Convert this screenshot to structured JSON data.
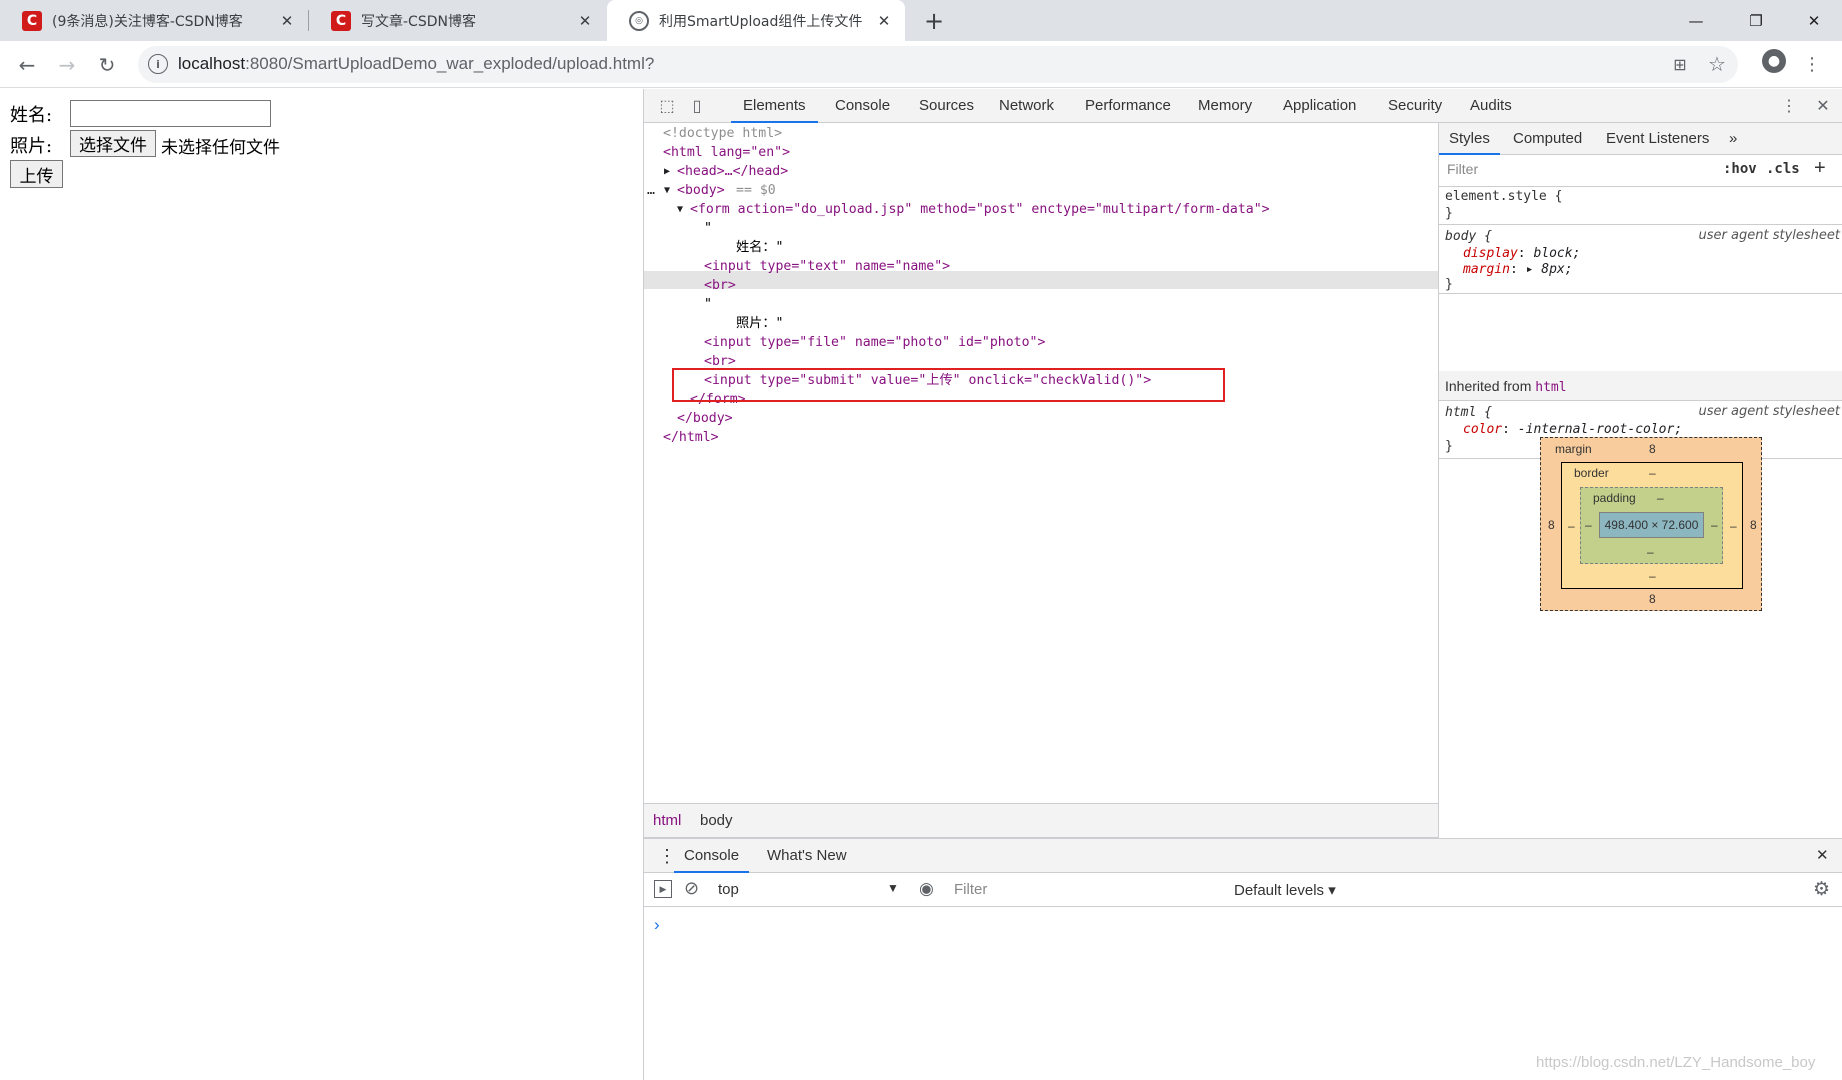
{
  "browser": {
    "tabs": [
      {
        "title": "(9条消息)关注博客-CSDN博客",
        "favicon": "csdn-logo"
      },
      {
        "title": "写文章-CSDN博客",
        "favicon": "csdn-logo"
      },
      {
        "title": "利用SmartUpload组件上传文件",
        "favicon": "globe-icon"
      }
    ],
    "active_tab": 2,
    "url_host": "localhost",
    "url_rest": ":8080/SmartUploadDemo_war_exploded/upload.html?"
  },
  "page": {
    "name_label": "姓名:",
    "photo_label": "照片:",
    "choose_file": "选择文件",
    "no_file": "未选择任何文件",
    "submit": "上传"
  },
  "devtools": {
    "tabs": [
      "Elements",
      "Console",
      "Sources",
      "Network",
      "Performance",
      "Memory",
      "Application",
      "Security",
      "Audits"
    ],
    "selected_tab": "Elements",
    "dom": {
      "doctype": "<!doctype html>",
      "html_open": "<html lang=\"en\">",
      "head": "<head>…</head>",
      "body_open": "<body>",
      "body_eq": "== $0",
      "form_open": "<form action=\"do_upload.jsp\" method=\"post\" enctype=\"multipart/form-data\">",
      "quote1": "\"",
      "text_name": "姓名：\"",
      "input_text": "<input type=\"text\" name=\"name\">",
      "br1": "<br>",
      "quote2": "\"",
      "text_photo": "照片：\"",
      "input_file": "<input type=\"file\" name=\"photo\" id=\"photo\">",
      "br2": "<br>",
      "input_submit": "<input type=\"submit\" value=\"上传\" onclick=\"checkValid()\">",
      "form_close": "</form>",
      "body_close": "</body>",
      "html_close": "</html>"
    },
    "styles": {
      "tabs": [
        "Styles",
        "Computed",
        "Event Listeners"
      ],
      "filter_placeholder": "Filter",
      "hov": ":hov",
      "cls": ".cls",
      "element_style": "element.style {",
      "close_brace": "}",
      "body_selector": "body {",
      "ua": "user agent stylesheet",
      "display_prop": "display",
      "display_val": "block;",
      "margin_prop": "margin",
      "margin_val": "8px;",
      "inherited_label": "Inherited from",
      "inherited_tag": "html",
      "html_selector": "html {",
      "color_prop": "color",
      "color_val": "-internal-root-color;"
    },
    "box_model": {
      "margin_label": "margin",
      "margin_top": "8",
      "margin_bottom": "8",
      "margin_left": "8",
      "margin_right": "8",
      "border_label": "border",
      "border_val": "–",
      "padding_label": "padding",
      "padding_val": "–",
      "content": "498.400 × 72.600"
    },
    "breadcrumbs": [
      "html",
      "body"
    ],
    "drawer": {
      "tabs": [
        "Console",
        "What's New"
      ],
      "context": "top",
      "filter_placeholder": "Filter",
      "levels": "Default levels ▾",
      "prompt": "›"
    }
  },
  "watermark": "https://blog.csdn.net/LZY_Handsome_boy"
}
